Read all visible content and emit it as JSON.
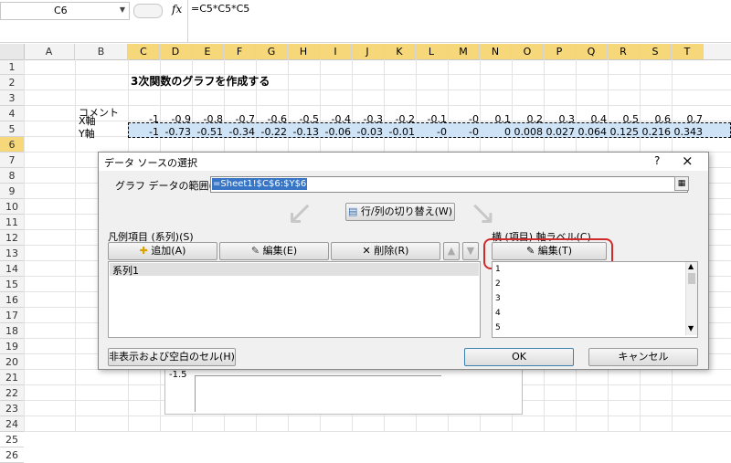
{
  "formula_bar": {
    "cell_ref": "C6",
    "fx": "fx",
    "formula": "=C5*C5*C5"
  },
  "columns": [
    "A",
    "B",
    "C",
    "D",
    "E",
    "F",
    "G",
    "H",
    "I",
    "J",
    "K",
    "L",
    "M",
    "N",
    "O",
    "P",
    "Q",
    "R",
    "S",
    "T"
  ],
  "rows": [
    "1",
    "2",
    "3",
    "4",
    "5",
    "6",
    "7",
    "8",
    "9",
    "10",
    "11",
    "12",
    "13",
    "14",
    "15",
    "16",
    "17",
    "18",
    "19",
    "20",
    "21",
    "22",
    "23",
    "24",
    "25",
    "26"
  ],
  "sheet": {
    "title": "3次関数のグラフを作成する",
    "comment_label": "コメント",
    "x_label": "X軸",
    "y_label": "Y軸",
    "x_values": [
      "-1",
      "-0.9",
      "-0.8",
      "-0.7",
      "-0.6",
      "-0.5",
      "-0.4",
      "-0.3",
      "-0.2",
      "-0.1",
      "-0",
      "0.1",
      "0.2",
      "0.3",
      "0.4",
      "0.5",
      "0.6",
      "0.7"
    ],
    "y_values": [
      "-1",
      "-0.73",
      "-0.51",
      "-0.34",
      "-0.22",
      "-0.13",
      "-0.06",
      "-0.03",
      "-0.01",
      "-0",
      "-0",
      "0",
      "0.008",
      "0.027",
      "0.064",
      "0.125",
      "0.216",
      "0.343"
    ],
    "chart_tick": "-1.5"
  },
  "dialog": {
    "title": "データ ソースの選択",
    "help": "?",
    "close": "×",
    "range_label": "グラフ データの範囲(D):",
    "range_value": "=Sheet1!$C$6:$Y$6",
    "switch_button": "行/列の切り替え(W)",
    "legend_label": "凡例項目 (系列)(S)",
    "add_button": "追加(A)",
    "edit_button": "編集(E)",
    "delete_button": "削除(R)",
    "series": [
      "系列1"
    ],
    "axis_label": "横 (項目) 軸ラベル(C)",
    "axis_edit_button": "編集(T)",
    "axis_items": [
      "1",
      "2",
      "3",
      "4",
      "5"
    ],
    "hidden_button": "非表示および空白のセル(H)",
    "ok_button": "OK",
    "cancel_button": "キャンセル"
  },
  "colors": {
    "highlight": "#d22a2a",
    "selected_header": "#f6d87a",
    "selection_fill": "#cfe3f7"
  }
}
